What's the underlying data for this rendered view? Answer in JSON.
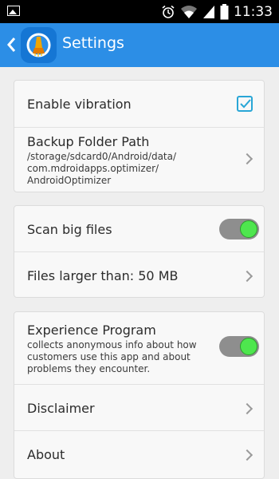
{
  "status_bar": {
    "time": "11:33",
    "icons": [
      "image-icon",
      "alarm-icon",
      "wifi-icon",
      "signal-icon",
      "battery-icon"
    ]
  },
  "app_bar": {
    "title": "Settings",
    "back_icon": "back-chevron-icon",
    "logo_icon": "broom-rocket-logo-icon",
    "color": "#2c8ee6"
  },
  "settings": {
    "enable_vibration": {
      "label": "Enable vibration",
      "checked": true
    },
    "backup_folder": {
      "label": "Backup Folder Path",
      "path_line1": "/storage/sdcard0/Android/data/",
      "path_line2": "com.mdroidapps.optimizer/",
      "path_line3": "AndroidOptimizer"
    },
    "scan_big_files": {
      "label": "Scan big files",
      "enabled": true
    },
    "files_larger": {
      "label": "Files larger than: 50 MB"
    },
    "experience_program": {
      "label": "Experience Program",
      "desc_line1": "collects anonymous info about how",
      "desc_line2": "customers use this app and about",
      "desc_line3": "problems they encounter.",
      "enabled": true
    },
    "disclaimer": {
      "label": "Disclaimer"
    },
    "about": {
      "label": "About"
    }
  },
  "colors": {
    "accent_checkbox": "#29a6d6",
    "toggle_on_knob": "#4ee64e",
    "background": "#eeeeee"
  }
}
